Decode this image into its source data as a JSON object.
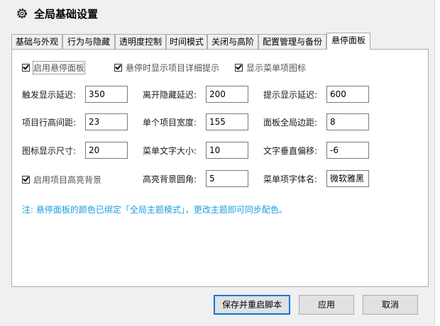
{
  "window": {
    "title": "全局基础设置",
    "icon": "gear-icon"
  },
  "tabs": [
    {
      "label": "基础与外观",
      "active": false
    },
    {
      "label": "行为与隐藏",
      "active": false
    },
    {
      "label": "透明度控制",
      "active": false
    },
    {
      "label": "时间模式",
      "active": false
    },
    {
      "label": "关闭与高阶",
      "active": false
    },
    {
      "label": "配置管理与备份",
      "active": false
    },
    {
      "label": "悬停面板",
      "active": true
    }
  ],
  "checkboxes": {
    "enable_panel": {
      "label": "启用悬停面板",
      "checked": true
    },
    "show_detail_tip": {
      "label": "悬停时显示项目详细提示",
      "checked": true
    },
    "show_menu_icon": {
      "label": "显示菜单项图标",
      "checked": true
    },
    "enable_highlight": {
      "label": "启用项目高亮背景",
      "checked": true
    }
  },
  "fields": {
    "trigger_delay": {
      "label": "触发显示延迟:",
      "value": "350"
    },
    "leave_delay": {
      "label": "离开隐藏延迟:",
      "value": "200"
    },
    "tip_delay": {
      "label": "提示显示延迟:",
      "value": "600"
    },
    "row_spacing": {
      "label": "项目行高间距:",
      "value": "23"
    },
    "item_width": {
      "label": "单个项目宽度:",
      "value": "155"
    },
    "panel_margin": {
      "label": "面板全局边距:",
      "value": "8"
    },
    "icon_size": {
      "label": "图标显示尺寸:",
      "value": "20"
    },
    "menu_font_size": {
      "label": "菜单文字大小:",
      "value": "10"
    },
    "text_vertical_offset": {
      "label": "文字垂直偏移:",
      "value": "-6"
    },
    "highlight_radius": {
      "label": "高亮背景圆角:",
      "value": "5"
    },
    "menu_font_family": {
      "label": "菜单项字体名:",
      "value": "微软雅黑"
    }
  },
  "note": "注: 悬停面板的颜色已绑定「全局主题模式」，更改主题即可同步配色。",
  "buttons": {
    "save_restart": "保存并重启脚本",
    "apply": "应用",
    "cancel": "取消"
  },
  "colors": {
    "note": "#1e9fe0",
    "primary_border": "#0078d7"
  }
}
